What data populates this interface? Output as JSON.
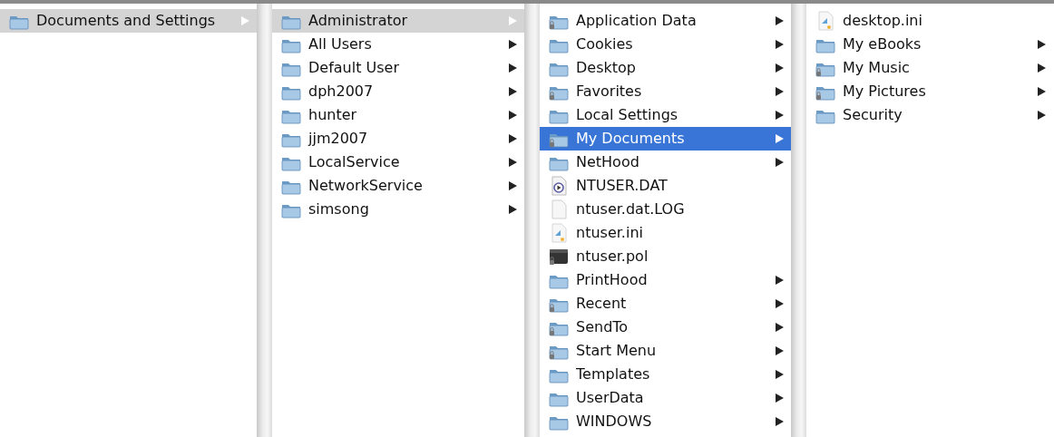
{
  "columns": [
    {
      "active": false,
      "items": [
        {
          "name": "Documents and Settings",
          "kind": "folder",
          "locked": false,
          "selected": true
        }
      ]
    },
    {
      "active": false,
      "items": [
        {
          "name": "Administrator",
          "kind": "folder",
          "locked": false,
          "selected": true
        },
        {
          "name": "All Users",
          "kind": "folder",
          "locked": false,
          "selected": false
        },
        {
          "name": "Default User",
          "kind": "folder",
          "locked": false,
          "selected": false
        },
        {
          "name": "dph2007",
          "kind": "folder",
          "locked": false,
          "selected": false
        },
        {
          "name": "hunter",
          "kind": "folder",
          "locked": false,
          "selected": false
        },
        {
          "name": "jjm2007",
          "kind": "folder",
          "locked": false,
          "selected": false
        },
        {
          "name": "LocalService",
          "kind": "folder",
          "locked": false,
          "selected": false
        },
        {
          "name": "NetworkService",
          "kind": "folder",
          "locked": false,
          "selected": false
        },
        {
          "name": "simsong",
          "kind": "folder",
          "locked": false,
          "selected": false
        }
      ]
    },
    {
      "active": true,
      "items": [
        {
          "name": "Application Data",
          "kind": "folder",
          "locked": true,
          "selected": false
        },
        {
          "name": "Cookies",
          "kind": "folder",
          "locked": false,
          "selected": false
        },
        {
          "name": "Desktop",
          "kind": "folder",
          "locked": false,
          "selected": false
        },
        {
          "name": "Favorites",
          "kind": "folder",
          "locked": true,
          "selected": false
        },
        {
          "name": "Local Settings",
          "kind": "folder",
          "locked": false,
          "selected": false
        },
        {
          "name": "My Documents",
          "kind": "folder",
          "locked": true,
          "selected": true
        },
        {
          "name": "NetHood",
          "kind": "folder",
          "locked": false,
          "selected": false
        },
        {
          "name": "NTUSER.DAT",
          "kind": "media",
          "locked": false,
          "selected": false
        },
        {
          "name": "ntuser.dat.LOG",
          "kind": "document",
          "locked": false,
          "selected": false
        },
        {
          "name": "ntuser.ini",
          "kind": "settings",
          "locked": false,
          "selected": false
        },
        {
          "name": "ntuser.pol",
          "kind": "binary",
          "locked": true,
          "selected": false
        },
        {
          "name": "PrintHood",
          "kind": "folder",
          "locked": false,
          "selected": false
        },
        {
          "name": "Recent",
          "kind": "folder",
          "locked": true,
          "selected": false
        },
        {
          "name": "SendTo",
          "kind": "folder",
          "locked": true,
          "selected": false
        },
        {
          "name": "Start Menu",
          "kind": "folder",
          "locked": true,
          "selected": false
        },
        {
          "name": "Templates",
          "kind": "folder",
          "locked": false,
          "selected": false
        },
        {
          "name": "UserData",
          "kind": "folder",
          "locked": false,
          "selected": false
        },
        {
          "name": "WINDOWS",
          "kind": "folder",
          "locked": false,
          "selected": false
        }
      ]
    },
    {
      "items": [
        {
          "name": "desktop.ini",
          "kind": "settings",
          "locked": false,
          "selected": false
        },
        {
          "name": "My eBooks",
          "kind": "folder",
          "locked": false,
          "selected": false
        },
        {
          "name": "My Music",
          "kind": "folder",
          "locked": true,
          "selected": false
        },
        {
          "name": "My Pictures",
          "kind": "folder",
          "locked": true,
          "selected": false
        },
        {
          "name": "Security",
          "kind": "folder",
          "locked": false,
          "selected": false
        }
      ]
    }
  ]
}
